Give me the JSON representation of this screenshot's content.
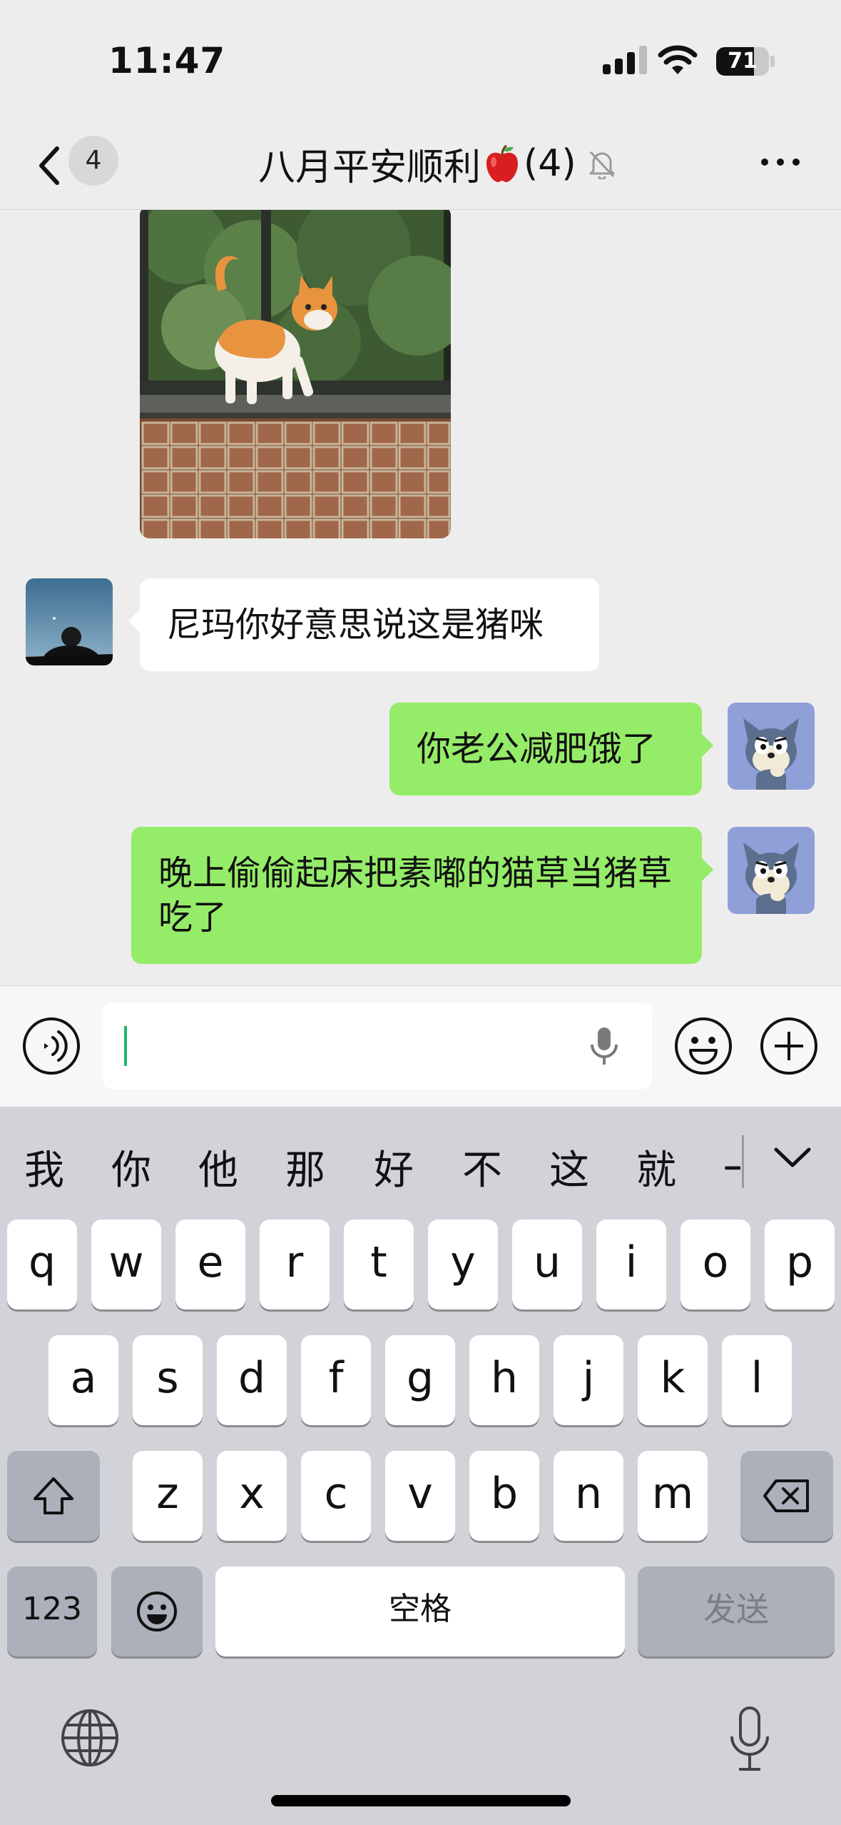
{
  "status_bar": {
    "time": "11:47",
    "battery_level": "71",
    "battery_fraction": 0.71
  },
  "nav": {
    "unread_count": "4",
    "title_text": "八月平安顺利",
    "title_emoji_icon": "red-apple-icon",
    "member_count": "(4)",
    "muted": true
  },
  "messages": [
    {
      "sender": "other",
      "type": "image",
      "content": "cat-photo"
    },
    {
      "sender": "other",
      "type": "text",
      "text": "尼玛你好意思说这是猪咪"
    },
    {
      "sender": "me",
      "type": "text",
      "text": "你老公减肥饿了"
    },
    {
      "sender": "me",
      "type": "text",
      "text": "晚上偷偷起床把素嘟的猫草当猪草吃了"
    }
  ],
  "input": {
    "value": ""
  },
  "keyboard": {
    "candidates": [
      "我",
      "你",
      "他",
      "那",
      "好",
      "不",
      "这",
      "就",
      "一"
    ],
    "row1": [
      "q",
      "w",
      "e",
      "r",
      "t",
      "y",
      "u",
      "i",
      "o",
      "p"
    ],
    "row2": [
      "a",
      "s",
      "d",
      "f",
      "g",
      "h",
      "j",
      "k",
      "l"
    ],
    "row3": [
      "z",
      "x",
      "c",
      "v",
      "b",
      "n",
      "m"
    ],
    "numbers_label": "123",
    "space_label": "空格",
    "send_label": "发送"
  },
  "colors": {
    "chat_background": "#ededed",
    "outgoing_bubble": "#95ec69",
    "incoming_bubble": "#ffffff",
    "keyboard_background": "#d1d3d9",
    "caret": "#1fb76b"
  }
}
